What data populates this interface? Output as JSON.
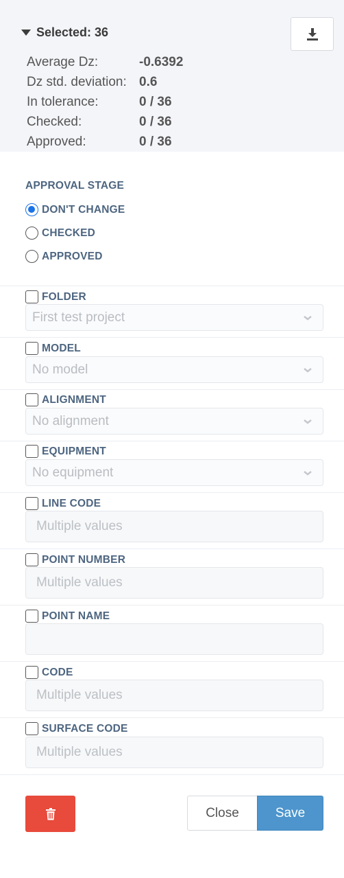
{
  "summary": {
    "title": "Selected: 36",
    "stats": [
      {
        "label": "Average Dz:",
        "value": "-0.6392"
      },
      {
        "label": "Dz std. deviation:",
        "value": "0.6"
      },
      {
        "label": "In tolerance:",
        "value": "0 / 36"
      },
      {
        "label": "Checked:",
        "value": "0 / 36"
      },
      {
        "label": "Approved:",
        "value": "0 / 36"
      }
    ]
  },
  "approval": {
    "title": "APPROVAL STAGE",
    "options": [
      {
        "label": "DON'T CHANGE",
        "checked": true
      },
      {
        "label": "CHECKED",
        "checked": false
      },
      {
        "label": "APPROVED",
        "checked": false
      }
    ]
  },
  "fields": {
    "folder": {
      "label": "FOLDER",
      "value": "First test project"
    },
    "model": {
      "label": "MODEL",
      "value": "No model"
    },
    "alignment": {
      "label": "ALIGNMENT",
      "value": "No alignment"
    },
    "equipment": {
      "label": "EQUIPMENT",
      "value": "No equipment"
    },
    "line_code": {
      "label": "LINE CODE",
      "placeholder": "Multiple values"
    },
    "point_number": {
      "label": "POINT NUMBER",
      "placeholder": "Multiple values"
    },
    "point_name": {
      "label": "POINT NAME",
      "placeholder": ""
    },
    "code": {
      "label": "CODE",
      "placeholder": "Multiple values"
    },
    "surface_code": {
      "label": "SURFACE CODE",
      "placeholder": "Multiple values"
    }
  },
  "actions": {
    "close_label": "Close",
    "save_label": "Save"
  },
  "icons": {
    "download": "download-icon",
    "delete": "trash-icon",
    "dropdown": "chevron-down-icon"
  },
  "colors": {
    "accent": "#1a73e8",
    "save": "#4d95cc",
    "delete": "#e84a3b",
    "section_label": "#4d6580"
  }
}
